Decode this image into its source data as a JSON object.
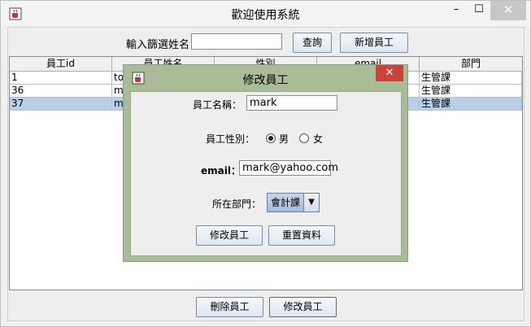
{
  "window": {
    "title": "歡迎使用系統",
    "icon": "java-coffee-icon",
    "min_glyph": "–",
    "max_glyph": "☐",
    "close_glyph": "✕"
  },
  "search": {
    "label": "輸入篩選姓名",
    "value": "",
    "query_button": "查詢",
    "add_button": "新增員工"
  },
  "table": {
    "columns": [
      "員工id",
      "員工姓名",
      "性別",
      "email",
      "部門"
    ],
    "rows": [
      {
        "id": "1",
        "name": "tom",
        "gender": "",
        "email": "",
        "dept": "生管課",
        "selected": false
      },
      {
        "id": "36",
        "name": "ma",
        "gender": "",
        "email": "",
        "dept": "生管課",
        "selected": false
      },
      {
        "id": "37",
        "name": "ma",
        "gender": "",
        "email": "",
        "dept": "生管課",
        "selected": true
      }
    ]
  },
  "footer": {
    "delete_button": "刪除員工",
    "edit_button": "修改員工"
  },
  "dialog": {
    "title": "修改員工",
    "close_glyph": "✕",
    "name_label": "員工名稱：",
    "name_value": "mark",
    "gender_label": "員工性別：",
    "gender_male": "男",
    "gender_female": "女",
    "gender_selected": "男",
    "email_label": "email：",
    "email_value": "mark@yahoo.com",
    "dept_label": "所在部門：",
    "dept_value": "會計課",
    "edit_button": "修改員工",
    "reset_button": "重置資料"
  }
}
